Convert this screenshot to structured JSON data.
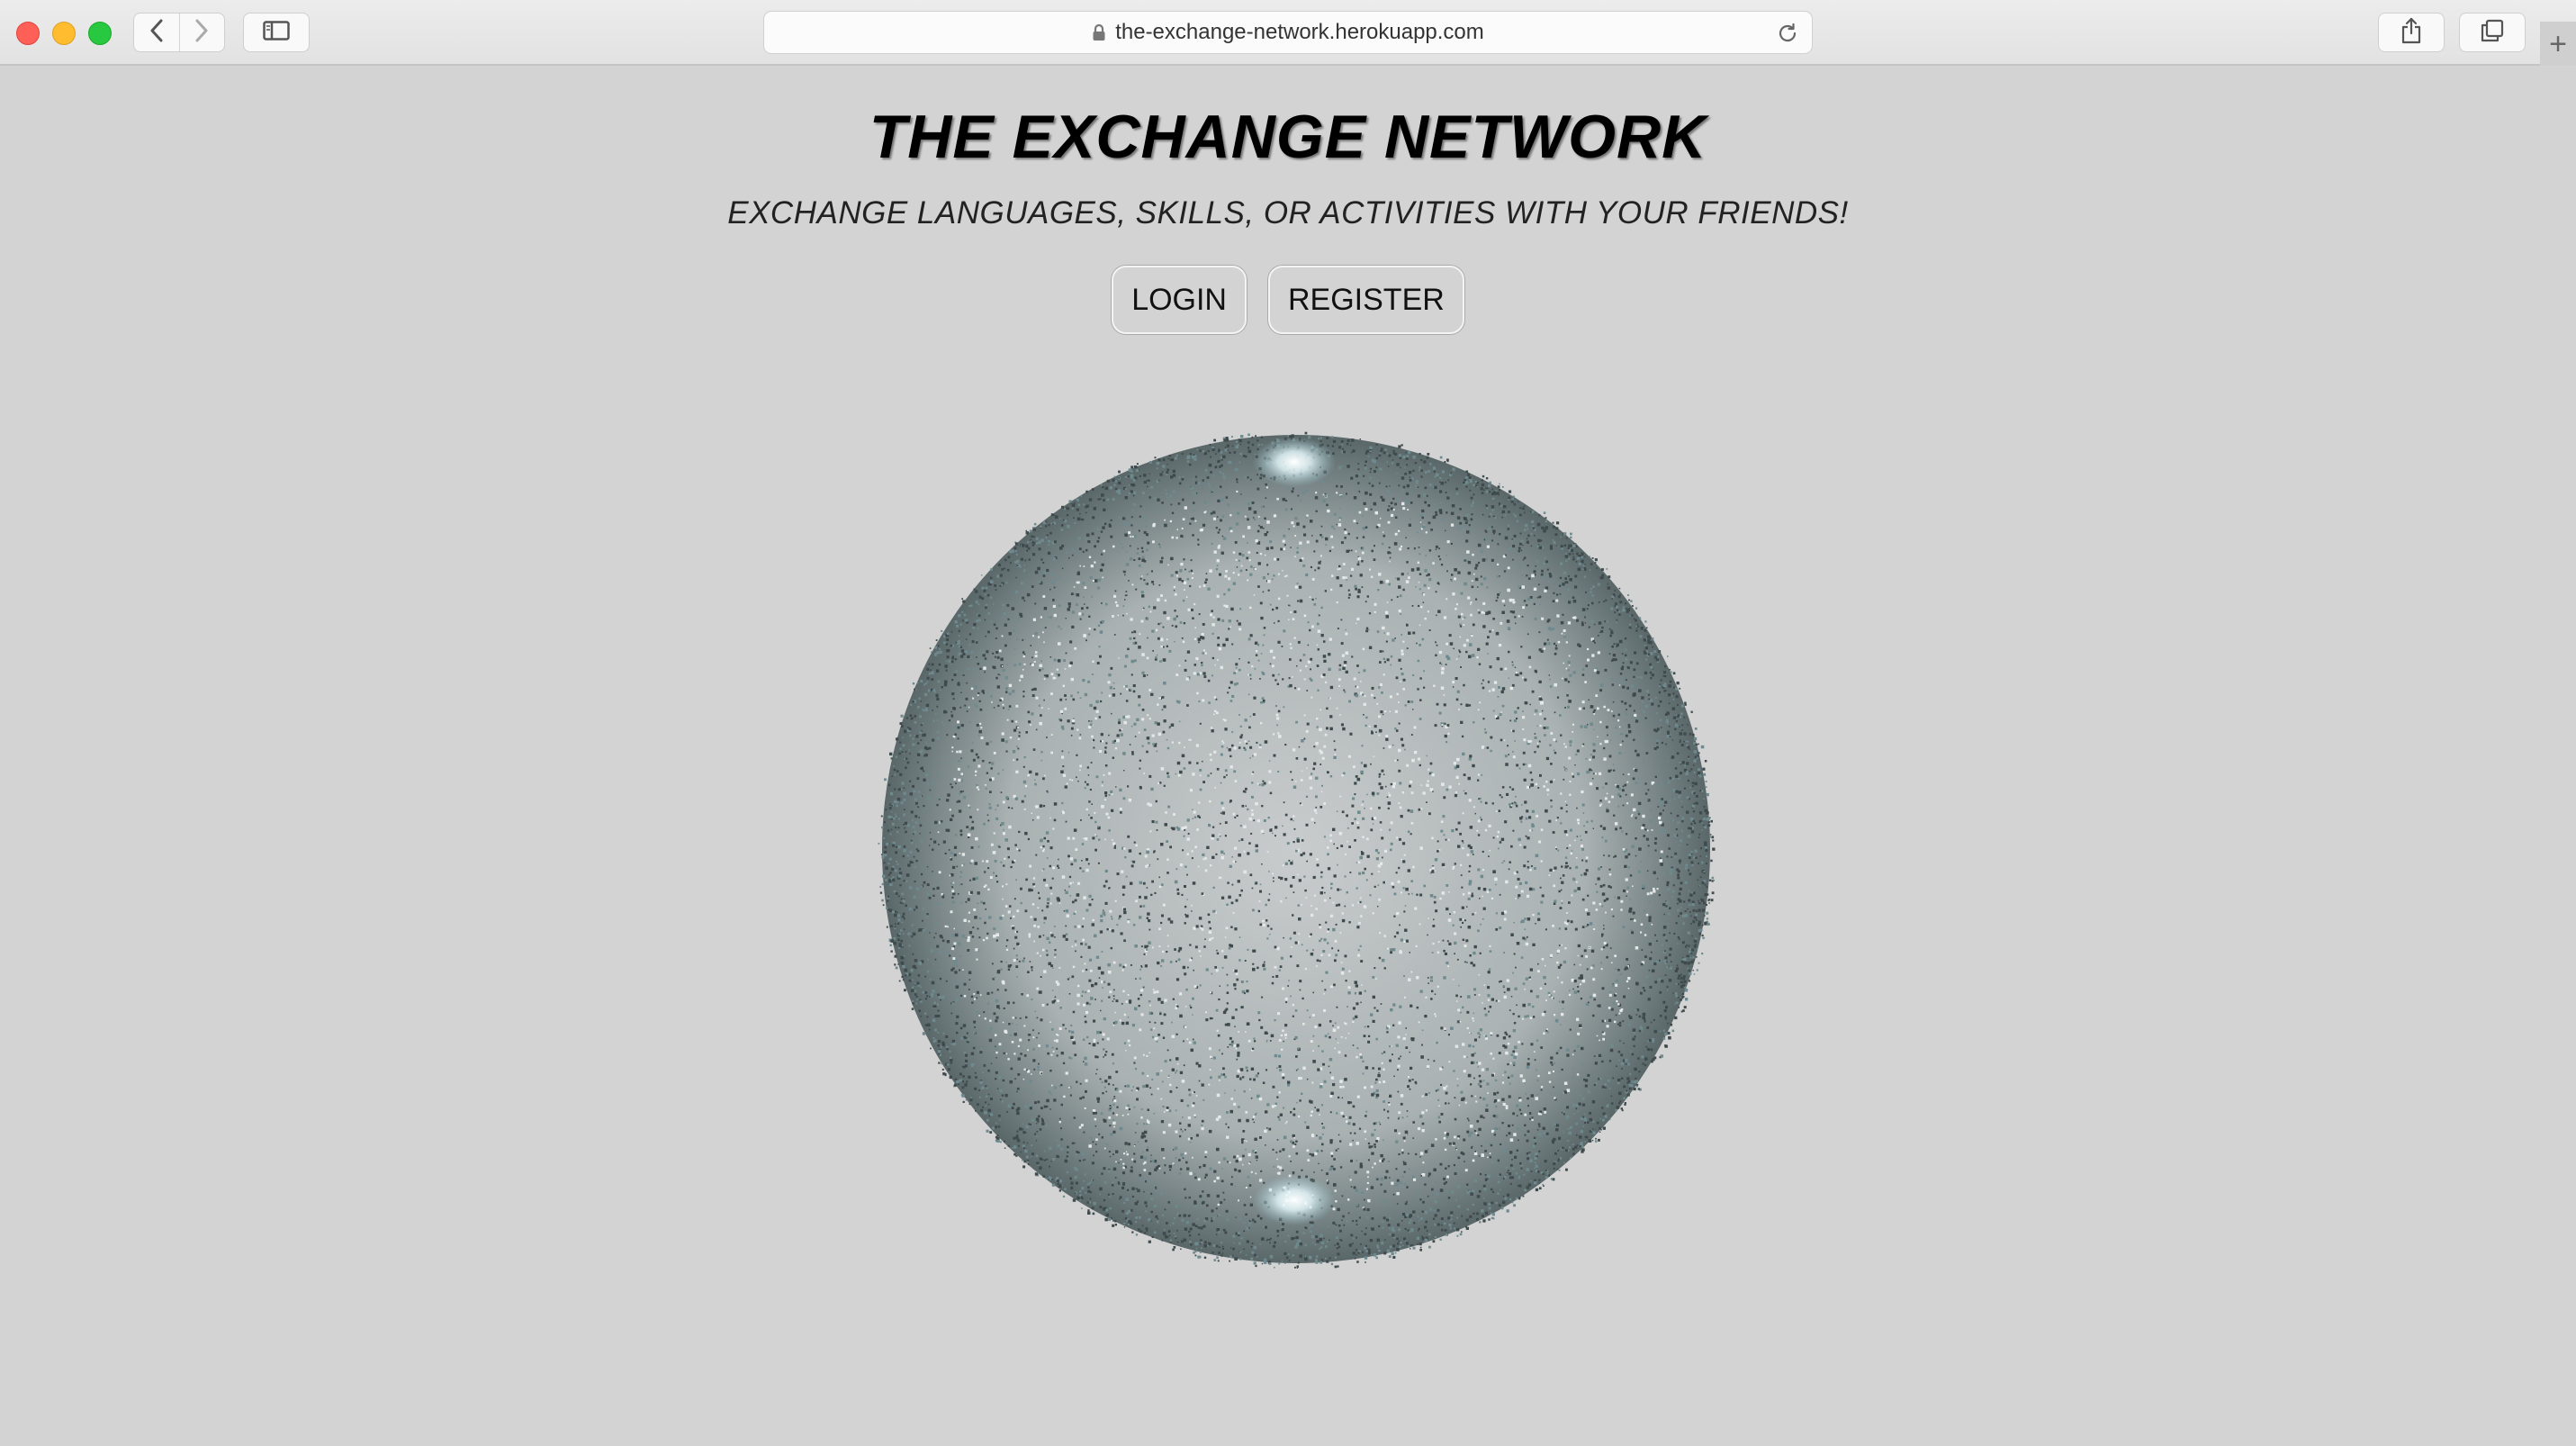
{
  "browser": {
    "url": "the-exchange-network.herokuapp.com",
    "new_tab_glyph": "+"
  },
  "page": {
    "title": "THE EXCHANGE NETWORK",
    "subtitle": "EXCHANGE LANGUAGES, SKILLS, OR ACTIVITIES WITH YOUR FRIENDS!",
    "buttons": {
      "login": "LOGIN",
      "register": "REGISTER"
    }
  },
  "colors": {
    "background": "#d3d3d3",
    "particle_dark": "#3f4a4c",
    "particle_teal": "#6f8a8e",
    "particle_light": "#e4e8e8",
    "glow": "#ffffff"
  },
  "icons": [
    "back-chevron-icon",
    "forward-chevron-icon",
    "sidebar-icon",
    "lock-icon",
    "reload-icon",
    "share-icon",
    "tabs-icon",
    "plus-icon"
  ]
}
